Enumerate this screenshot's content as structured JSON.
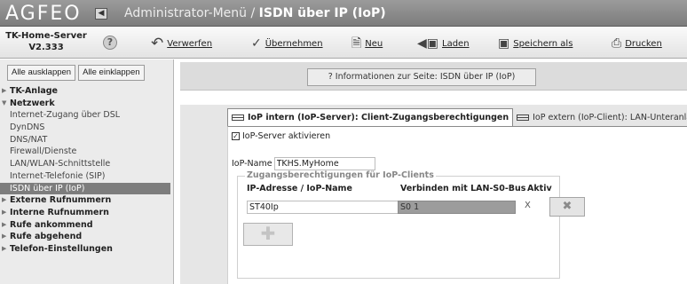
{
  "header": {
    "logo": "AGFEO",
    "back_icon": "back-arrow-icon",
    "title_prefix": "Administrator-Menü / ",
    "title_page": "ISDN über IP (IoP)"
  },
  "toolbar": {
    "server_name": "TK-Home-Server",
    "server_version": "V2.333",
    "help_label": "?",
    "discard_label": "Verwerfen",
    "apply_label": "Übernehmen",
    "new_label": "Neu",
    "load_label": "Laden",
    "save_as_label": "Speichern als",
    "print_label": "Drucken"
  },
  "sidebar": {
    "expand_all": "Alle ausklappen",
    "collapse_all": "Alle einklappen",
    "items": [
      {
        "type": "group",
        "label": "TK-Anlage",
        "open": false
      },
      {
        "type": "group",
        "label": "Netzwerk",
        "open": true
      },
      {
        "type": "sub",
        "label": "Internet-Zugang über DSL"
      },
      {
        "type": "sub",
        "label": "DynDNS"
      },
      {
        "type": "sub",
        "label": "DNS/NAT"
      },
      {
        "type": "sub",
        "label": "Firewall/Dienste"
      },
      {
        "type": "sub",
        "label": "LAN/WLAN-Schnittstelle"
      },
      {
        "type": "sub",
        "label": "Internet-Telefonie (SIP)"
      },
      {
        "type": "sub",
        "label": "ISDN über IP (IoP)",
        "active": true
      },
      {
        "type": "group",
        "label": "Externe Rufnummern",
        "open": false
      },
      {
        "type": "group",
        "label": "Interne Rufnummern",
        "open": false
      },
      {
        "type": "group",
        "label": "Rufe ankommend",
        "open": false
      },
      {
        "type": "group",
        "label": "Rufe abgehend",
        "open": false
      },
      {
        "type": "group",
        "label": "Telefon-Einstellungen",
        "open": false
      }
    ]
  },
  "main": {
    "info_button": "? Informationen zur Seite: ISDN über IP (IoP)",
    "tabs": [
      {
        "label": "IoP intern (IoP-Server): Client-Zugangsberechtigungen",
        "active": true
      },
      {
        "label": "IoP extern (IoP-Client): LAN-Unteranlage",
        "active": false
      }
    ],
    "server_active_checked": true,
    "server_active_label": "IoP-Server aktivieren",
    "iop_name_label": "IoP-Name",
    "iop_name_value": "TKHS.MyHome",
    "access": {
      "legend": "Zugangsberechtigungen für IoP-Clients",
      "col_ip": "IP-Adresse / IoP-Name",
      "col_bus": "Verbinden mit LAN-S0-Bus",
      "col_active": "Aktiv",
      "rows": [
        {
          "ip": "ST40Ip",
          "bus": "S0 1",
          "active": "X"
        }
      ]
    }
  }
}
